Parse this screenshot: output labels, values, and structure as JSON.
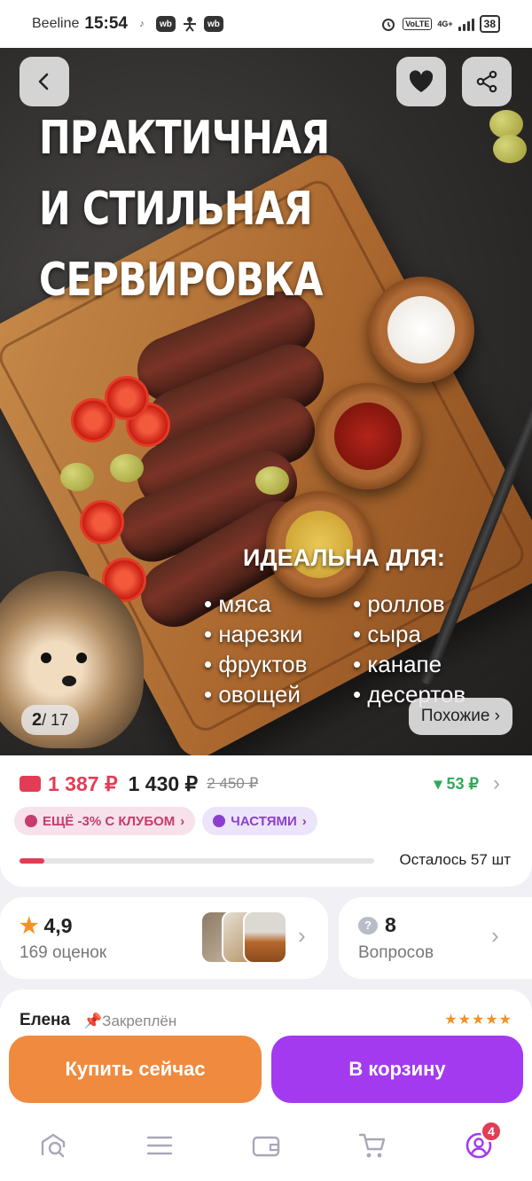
{
  "status_bar": {
    "carrier": "Beeline",
    "time": "15:54",
    "wb_label": "wb",
    "volte": "VoLTE",
    "network": "4G+",
    "battery": "38"
  },
  "hero": {
    "title_lines": [
      "ПРАКТИЧНАЯ",
      "И СТИЛЬНАЯ",
      "СЕРВИРОВКА"
    ],
    "ideal_title": "ИДЕАЛЬНА ДЛЯ:",
    "ideal_items": [
      "мяса",
      "роллов",
      "нарезки",
      "сыра",
      "фруктов",
      "канапе",
      "овощей",
      "десертов"
    ],
    "pager_current": "2",
    "pager_total": "/ 17",
    "similar_label": "Похожие ›"
  },
  "price": {
    "wallet_price": "1 387 ₽",
    "price": "1 430 ₽",
    "old_price": "2 450 ₽",
    "cashback": "▾ 53 ₽",
    "chevron": "›",
    "club_tag": "ЕЩЁ -3% С КЛУБОМ",
    "parts_tag": "ЧАСТЯМИ",
    "tag_chevron": "›",
    "stock_progress": 0.07,
    "remaining": "Осталось 57 шт"
  },
  "rating": {
    "value": "4,9",
    "count": "169 оценок",
    "chevron": "›"
  },
  "questions": {
    "count": "8",
    "label": "Вопросов",
    "chevron": "›"
  },
  "review": {
    "author": "Елена",
    "pinned": "Закреплён",
    "stars": "★★★★★"
  },
  "actions": {
    "buy_now": "Купить сейчас",
    "add_to_cart": "В корзину"
  },
  "nav": {
    "profile_badge": "4"
  },
  "colors": {
    "accent_purple": "#a33af0",
    "accent_orange": "#f08a3f",
    "price_red": "#e23d55",
    "cashback_green": "#2faa5a"
  }
}
